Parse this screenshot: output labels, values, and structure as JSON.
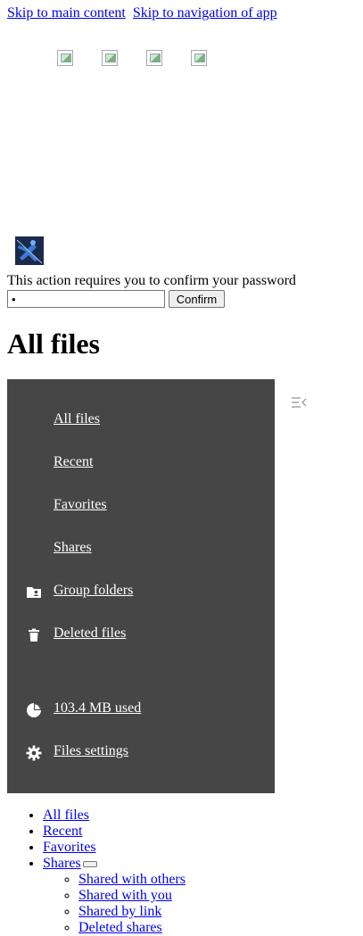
{
  "skip_links": {
    "main": "Skip to main content",
    "nav": "Skip to navigation of app"
  },
  "header_apps": [
    "app-icon-1",
    "app-icon-2",
    "app-icon-3",
    "app-icon-4"
  ],
  "password_confirm": {
    "message": "This action requires you to confirm your password",
    "value": "•",
    "button": "Confirm"
  },
  "page_title": "All files",
  "sidebar": {
    "items": [
      {
        "label": "All files",
        "icon": ""
      },
      {
        "label": "Recent",
        "icon": ""
      },
      {
        "label": "Favorites",
        "icon": ""
      },
      {
        "label": "Shares",
        "icon": ""
      },
      {
        "label": "Group folders",
        "icon": "folder-account-icon"
      },
      {
        "label": "Deleted files",
        "icon": "trash-icon"
      }
    ],
    "quota": "103.4 MB used",
    "settings": "Files settings",
    "bg_color": "#464646"
  },
  "nav_list": {
    "items": [
      "All files",
      "Recent",
      "Favorites",
      "Shares"
    ],
    "shares_sub": [
      "Shared with others",
      "Shared with you",
      "Shared by link",
      "Deleted shares"
    ]
  }
}
